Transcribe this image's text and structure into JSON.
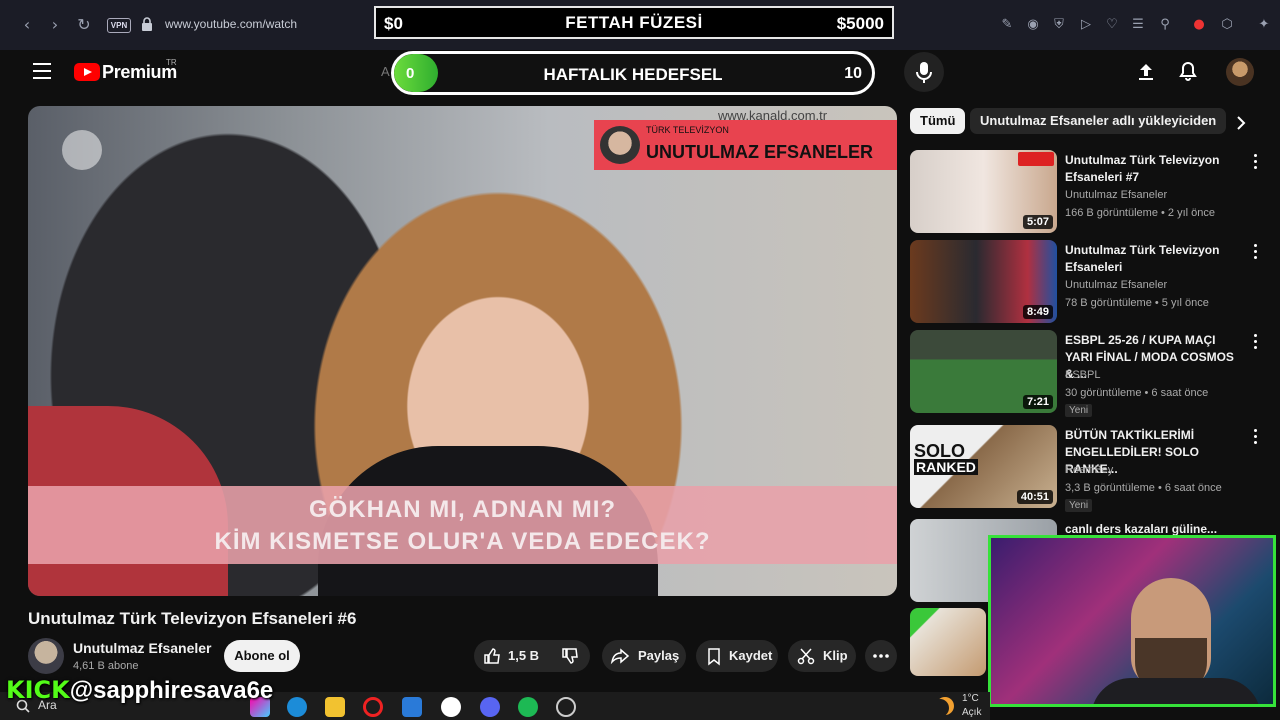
{
  "browser": {
    "url": "www.youtube.com/watch",
    "vpn_label": "VPN"
  },
  "donation": {
    "left": "$0",
    "title": "FETTAH FÜZESİ",
    "right": "$5000"
  },
  "header": {
    "brand": "Premium",
    "region": "TR",
    "search_prefix": "A"
  },
  "goal": {
    "current": "0",
    "title": "HAFTALIK HEDEFSEL",
    "target": "10",
    "progress": 0
  },
  "video": {
    "watermark_sub": "TÜRK TELEVİZYON",
    "watermark_title": "UNUTULMAZ EFSANELER",
    "site": "www.kanald.com.tr",
    "subtitle_line1": "GÖKHAN MI, ADNAN MI?",
    "subtitle_line2": "KİM KISMETSE OLUR'A VEDA EDECEK?",
    "title": "Unutulmaz Türk Televizyon Efsaneleri #6"
  },
  "channel": {
    "name": "Unutulmaz Efsaneler",
    "subs": "4,61 B abone",
    "subscribe": "Abone ol"
  },
  "actions": {
    "likes": "1,5 B",
    "share": "Paylaş",
    "save": "Kaydet",
    "clip": "Klip"
  },
  "chips": [
    "Tümü",
    "Unutulmaz Efsaneler adlı yükleyiciden"
  ],
  "recommendations": [
    {
      "title": "Unutulmaz Türk Televizyon Efsaneleri #7",
      "channel": "Unutulmaz Efsaneler",
      "meta": "166 B görüntüleme • 2 yıl önce",
      "duration": "5:07",
      "new": ""
    },
    {
      "title": "Unutulmaz Türk Televizyon Efsaneleri",
      "channel": "Unutulmaz Efsaneler",
      "meta": "78 B görüntüleme • 5 yıl önce",
      "duration": "8:49",
      "new": ""
    },
    {
      "title": "ESBPL 25-26 / KUPA MAÇI YARI FİNAL / MODA COSMOS & ...",
      "channel": "ESBPL",
      "meta": "30 görüntüleme • 6 saat önce",
      "duration": "7:21",
      "new": "Yeni"
    },
    {
      "title": "BÜTÜN TAKTİKLERİMİ ENGELLEDİLER! SOLO RANKE...",
      "channel": "ReemBey",
      "meta": "3,3 B görüntüleme • 6 saat önce",
      "duration": "40:51",
      "new": "Yeni"
    },
    {
      "title": "canlı ders kazaları güline...",
      "channel": "",
      "meta": "",
      "duration": "",
      "new": ""
    }
  ],
  "thumb_text": {
    "solo": "SOLO",
    "ranked": "RANKED"
  },
  "overlay": {
    "kick_logo": "KICK",
    "handle": "@sapphiresava6e"
  },
  "taskbar": {
    "search": "Ara",
    "temp": "1°C",
    "weather": "Açık"
  },
  "colors": {
    "accent": "#ff0000",
    "goal_green": "#53fc18",
    "donation_bg": "#000000"
  }
}
